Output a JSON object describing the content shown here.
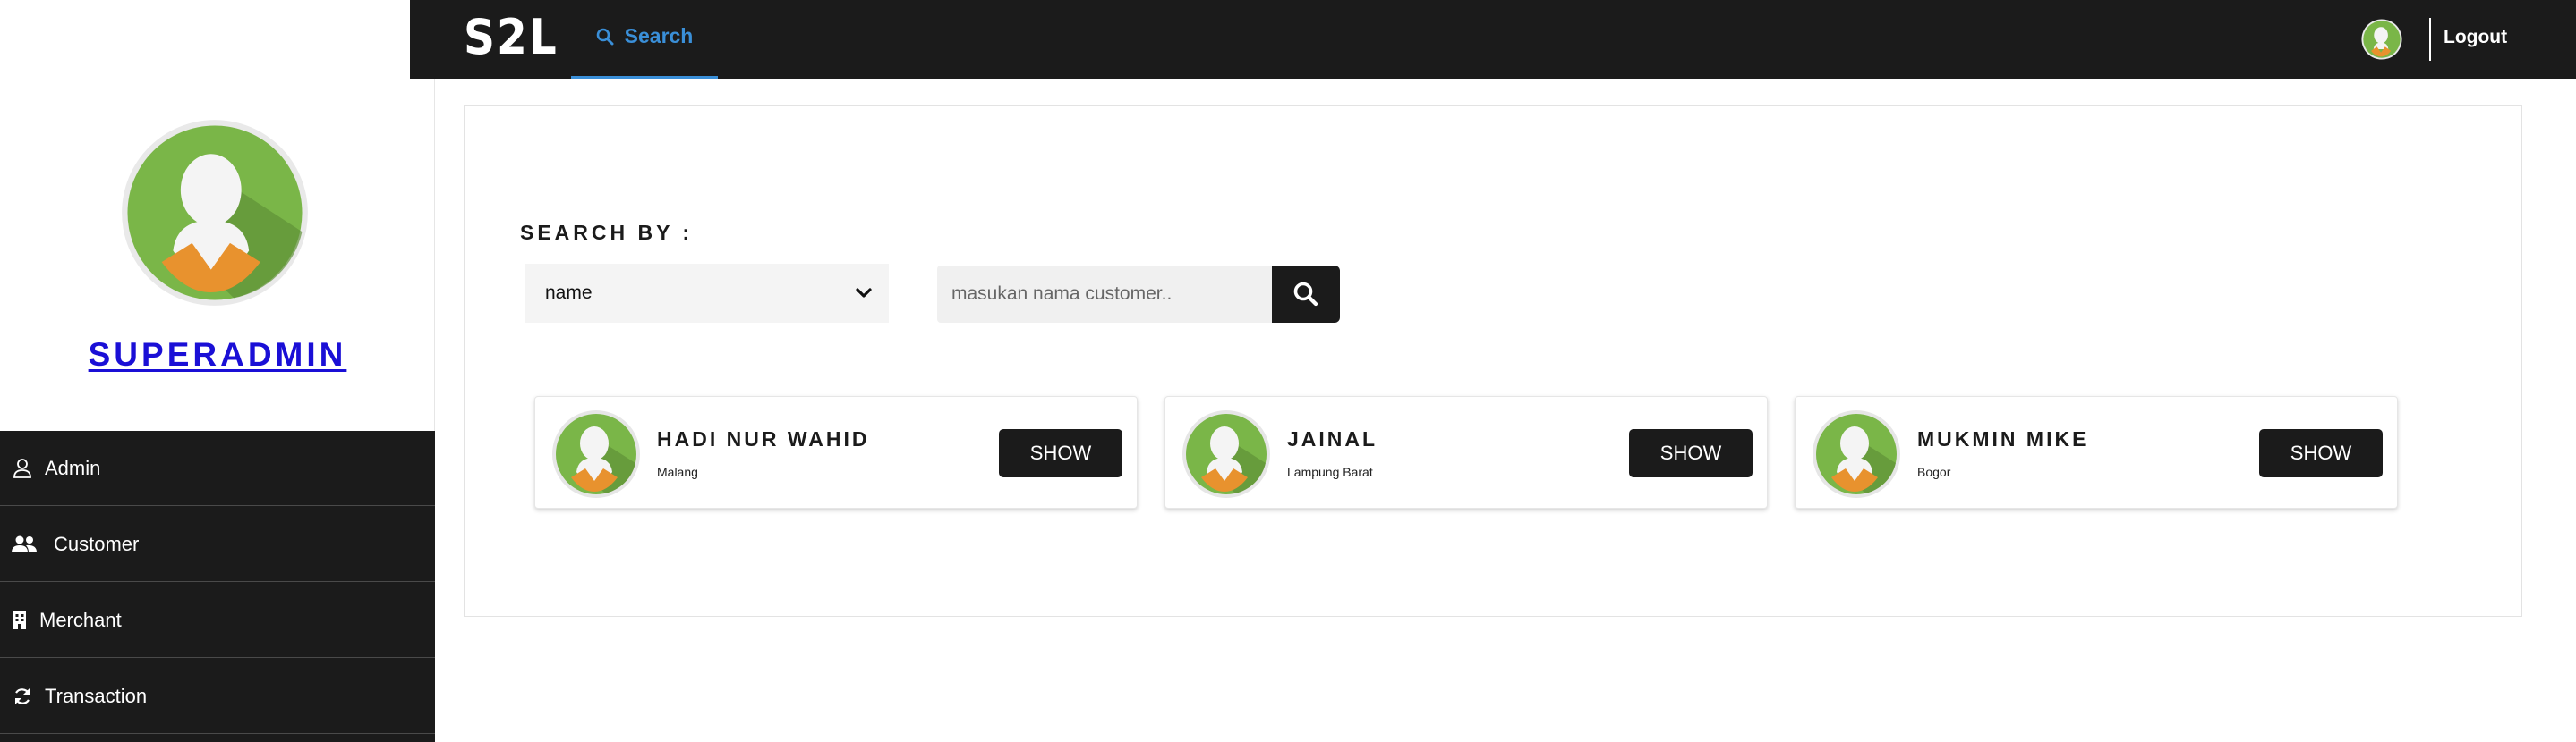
{
  "colors": {
    "dark": "#1b1b1b",
    "accent_blue": "#3a8fd8",
    "admin_link": "#1a0fd6",
    "avatar_green": "#7ab648",
    "avatar_orange": "#e8922e"
  },
  "sidebar": {
    "profile": {
      "name": "SUPERADMIN",
      "avatar_icon": "user-avatar-icon"
    },
    "items": [
      {
        "label": "Admin",
        "icon": "user-icon"
      },
      {
        "label": "Customer",
        "icon": "users-icon"
      },
      {
        "label": "Merchant",
        "icon": "building-icon"
      },
      {
        "label": "Transaction",
        "icon": "refresh-icon"
      }
    ]
  },
  "header": {
    "brand": "S2L",
    "tab_search": "Search",
    "logout": "Logout"
  },
  "search": {
    "label": "SEARCH BY :",
    "select_value": "name",
    "placeholder": "masukan nama customer.."
  },
  "results": [
    {
      "name": "HADI NUR WAHID",
      "city": "Malang",
      "button": "SHOW"
    },
    {
      "name": "JAINAL",
      "city": "Lampung Barat",
      "button": "SHOW"
    },
    {
      "name": "MUKMIN MIKE",
      "city": "Bogor",
      "button": "SHOW"
    }
  ]
}
